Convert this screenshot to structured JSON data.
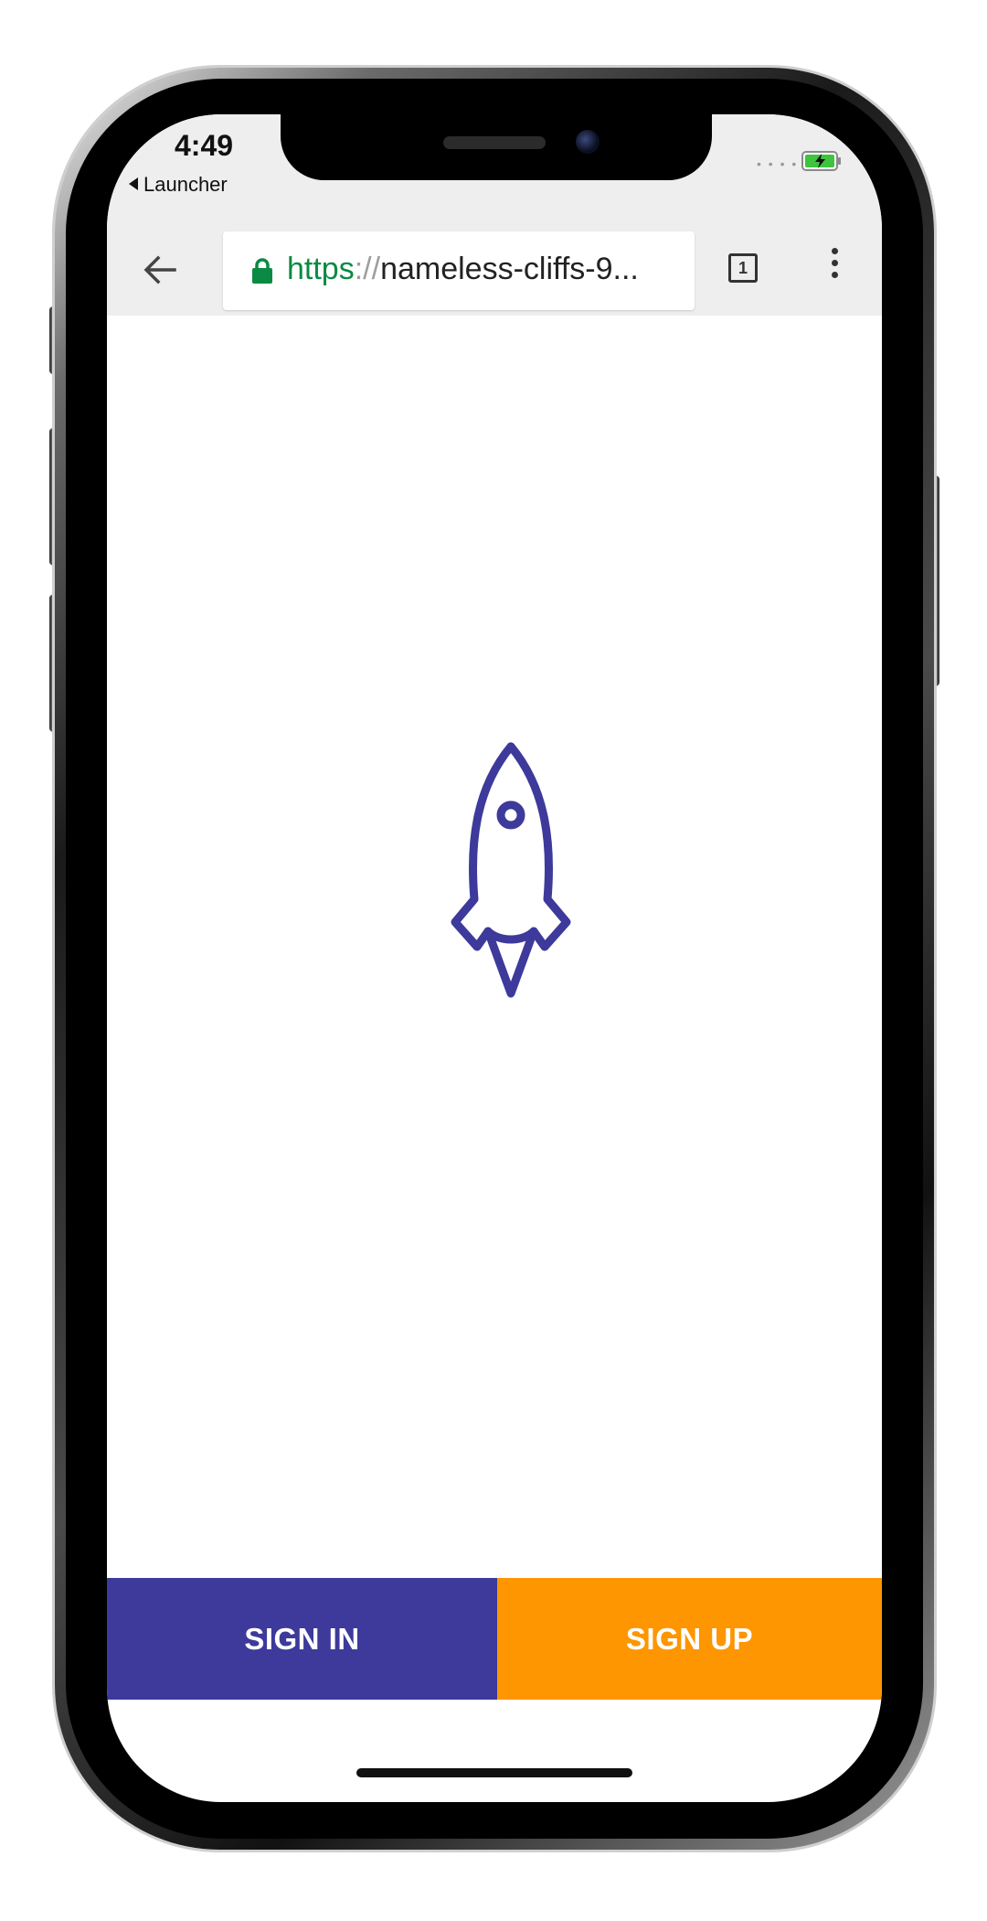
{
  "status_bar": {
    "time": "4:49",
    "back_app_label": "Launcher",
    "signal_icon": "signal-dots-icon",
    "battery_icon": "battery-charging-icon",
    "battery_color": "#3ec43e"
  },
  "browser": {
    "url_scheme": "https",
    "url_separator": "://",
    "url_host": "nameless-cliffs-9...",
    "url_scheme_color": "#0b8a43",
    "tab_count": "1",
    "back_icon": "back-arrow-icon",
    "lock_icon": "lock-icon",
    "menu_icon": "overflow-menu-icon"
  },
  "page": {
    "logo_icon": "rocket-icon",
    "logo_color": "#3d3a9b",
    "sign_in_label": "SIGN IN",
    "sign_up_label": "SIGN UP",
    "sign_in_color": "#3d3a9b",
    "sign_up_color": "#fd9600"
  }
}
